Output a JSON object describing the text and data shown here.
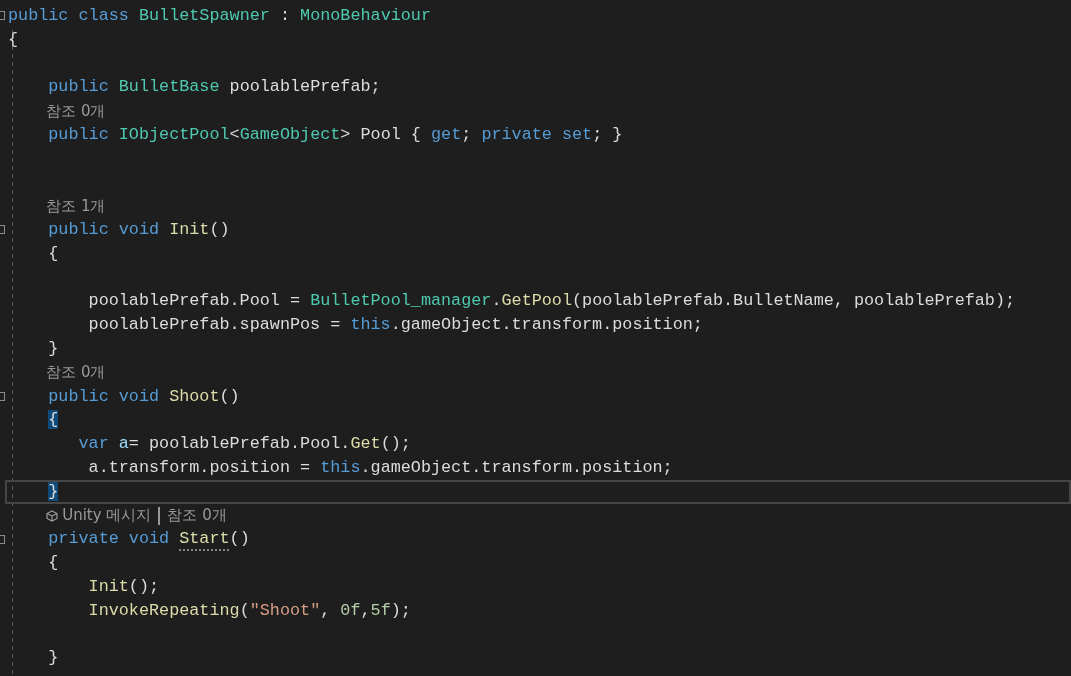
{
  "lines": [
    {
      "kind": "code",
      "fold": true,
      "current": false,
      "tokens": [
        {
          "text": "public class ",
          "kind": "keyword"
        },
        {
          "text": "BulletSpawner",
          "kind": "type"
        },
        {
          "text": " : ",
          "kind": "plain"
        },
        {
          "text": "MonoBehaviour",
          "kind": "type"
        }
      ]
    },
    {
      "kind": "code",
      "fold": false,
      "current": false,
      "tokens": [
        {
          "text": "{",
          "kind": "plain"
        }
      ]
    },
    {
      "kind": "blank"
    },
    {
      "kind": "code",
      "fold": false,
      "current": false,
      "tokens": [
        {
          "text": "    public ",
          "kind": "keyword"
        },
        {
          "text": "BulletBase",
          "kind": "type"
        },
        {
          "text": " poolablePrefab;",
          "kind": "plain"
        }
      ]
    },
    {
      "kind": "lens",
      "unity": false,
      "parts": [
        "참조 0개"
      ]
    },
    {
      "kind": "code",
      "fold": false,
      "current": false,
      "tokens": [
        {
          "text": "    public ",
          "kind": "keyword"
        },
        {
          "text": "IObjectPool",
          "kind": "type"
        },
        {
          "text": "<",
          "kind": "plain"
        },
        {
          "text": "GameObject",
          "kind": "type"
        },
        {
          "text": "> Pool { ",
          "kind": "plain"
        },
        {
          "text": "get",
          "kind": "keyword"
        },
        {
          "text": "; ",
          "kind": "plain"
        },
        {
          "text": "private set",
          "kind": "keyword"
        },
        {
          "text": "; }",
          "kind": "plain"
        }
      ]
    },
    {
      "kind": "blank"
    },
    {
      "kind": "blank"
    },
    {
      "kind": "lens",
      "unity": false,
      "parts": [
        "참조 1개"
      ]
    },
    {
      "kind": "code",
      "fold": true,
      "current": false,
      "tokens": [
        {
          "text": "    public void ",
          "kind": "keyword"
        },
        {
          "text": "Init",
          "kind": "method"
        },
        {
          "text": "()",
          "kind": "plain"
        }
      ]
    },
    {
      "kind": "code",
      "fold": false,
      "current": false,
      "tokens": [
        {
          "text": "    {",
          "kind": "plain"
        }
      ]
    },
    {
      "kind": "blank"
    },
    {
      "kind": "code",
      "fold": false,
      "current": false,
      "tokens": [
        {
          "text": "        poolablePrefab.Pool = ",
          "kind": "plain"
        },
        {
          "text": "BulletPool_manager",
          "kind": "type"
        },
        {
          "text": ".",
          "kind": "plain"
        },
        {
          "text": "GetPool",
          "kind": "method"
        },
        {
          "text": "(poolablePrefab.BulletName, poolablePrefab);",
          "kind": "plain"
        }
      ]
    },
    {
      "kind": "code",
      "fold": false,
      "current": false,
      "tokens": [
        {
          "text": "        poolablePrefab.spawnPos = ",
          "kind": "plain"
        },
        {
          "text": "this",
          "kind": "keyword"
        },
        {
          "text": ".gameObject.transform.position;",
          "kind": "plain"
        }
      ]
    },
    {
      "kind": "code",
      "fold": false,
      "current": false,
      "tokens": [
        {
          "text": "    }",
          "kind": "plain"
        }
      ]
    },
    {
      "kind": "lens",
      "unity": false,
      "parts": [
        "참조 0개"
      ]
    },
    {
      "kind": "code",
      "fold": true,
      "current": false,
      "tokens": [
        {
          "text": "    public void ",
          "kind": "keyword"
        },
        {
          "text": "Shoot",
          "kind": "method"
        },
        {
          "text": "()",
          "kind": "plain"
        }
      ]
    },
    {
      "kind": "code",
      "fold": false,
      "current": false,
      "tokens": [
        {
          "text": "    {",
          "kind": "brace-match"
        }
      ]
    },
    {
      "kind": "code",
      "fold": false,
      "current": false,
      "tokens": [
        {
          "text": "       var ",
          "kind": "keyword"
        },
        {
          "text": "a",
          "kind": "variable"
        },
        {
          "text": "= poolablePrefab.Pool.",
          "kind": "plain"
        },
        {
          "text": "Get",
          "kind": "method"
        },
        {
          "text": "();",
          "kind": "plain"
        }
      ]
    },
    {
      "kind": "code",
      "fold": false,
      "current": false,
      "tokens": [
        {
          "text": "        a.transform.position = ",
          "kind": "plain"
        },
        {
          "text": "this",
          "kind": "keyword"
        },
        {
          "text": ".gameObject.transform.position;",
          "kind": "plain"
        }
      ]
    },
    {
      "kind": "code",
      "fold": false,
      "current": true,
      "tokens": [
        {
          "text": "    }",
          "kind": "brace-match"
        }
      ]
    },
    {
      "kind": "lens",
      "unity": true,
      "parts": [
        "Unity 메시지",
        "참조 0개"
      ]
    },
    {
      "kind": "code",
      "fold": true,
      "current": false,
      "tokens": [
        {
          "text": "    private void ",
          "kind": "keyword"
        },
        {
          "text": "Start",
          "kind": "method-hint"
        },
        {
          "text": "()",
          "kind": "plain"
        }
      ]
    },
    {
      "kind": "code",
      "fold": false,
      "current": false,
      "tokens": [
        {
          "text": "    {",
          "kind": "plain"
        }
      ]
    },
    {
      "kind": "code",
      "fold": false,
      "current": false,
      "tokens": [
        {
          "text": "        Init",
          "kind": "method"
        },
        {
          "text": "();",
          "kind": "plain"
        }
      ]
    },
    {
      "kind": "code",
      "fold": false,
      "current": false,
      "tokens": [
        {
          "text": "        InvokeRepeating",
          "kind": "method"
        },
        {
          "text": "(",
          "kind": "plain"
        },
        {
          "text": "\"Shoot\"",
          "kind": "string"
        },
        {
          "text": ", ",
          "kind": "plain"
        },
        {
          "text": "0f",
          "kind": "number"
        },
        {
          "text": ",",
          "kind": "plain"
        },
        {
          "text": "5f",
          "kind": "number"
        },
        {
          "text": ");",
          "kind": "plain"
        }
      ]
    },
    {
      "kind": "blank"
    },
    {
      "kind": "code",
      "fold": false,
      "current": false,
      "tokens": [
        {
          "text": "    }",
          "kind": "plain"
        }
      ]
    }
  ]
}
